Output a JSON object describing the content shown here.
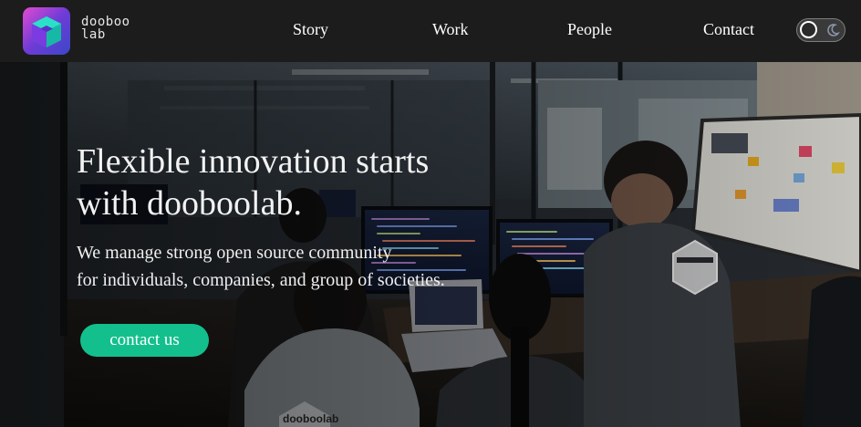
{
  "brand": {
    "name_line1": "dooboo",
    "name_line2": "lab",
    "logo_colors": [
      "#e14bd1",
      "#6f3bd6",
      "#2be0c8"
    ]
  },
  "nav": {
    "items": [
      {
        "label": "Story"
      },
      {
        "label": "Work"
      },
      {
        "label": "People"
      },
      {
        "label": "Contact"
      }
    ]
  },
  "theme_toggle": {
    "state": "dark",
    "icons": [
      "circle-knob-icon",
      "moon-icon"
    ]
  },
  "hero": {
    "title_line1": "Flexible innovation starts",
    "title_line2": "with dooboolab.",
    "subtitle_line1": "We manage strong open source community",
    "subtitle_line2": "for individuals, companies, and group of societies.",
    "cta_label": "contact us",
    "cta_color": "#13c08d",
    "shirt_text": "dooboolab"
  }
}
